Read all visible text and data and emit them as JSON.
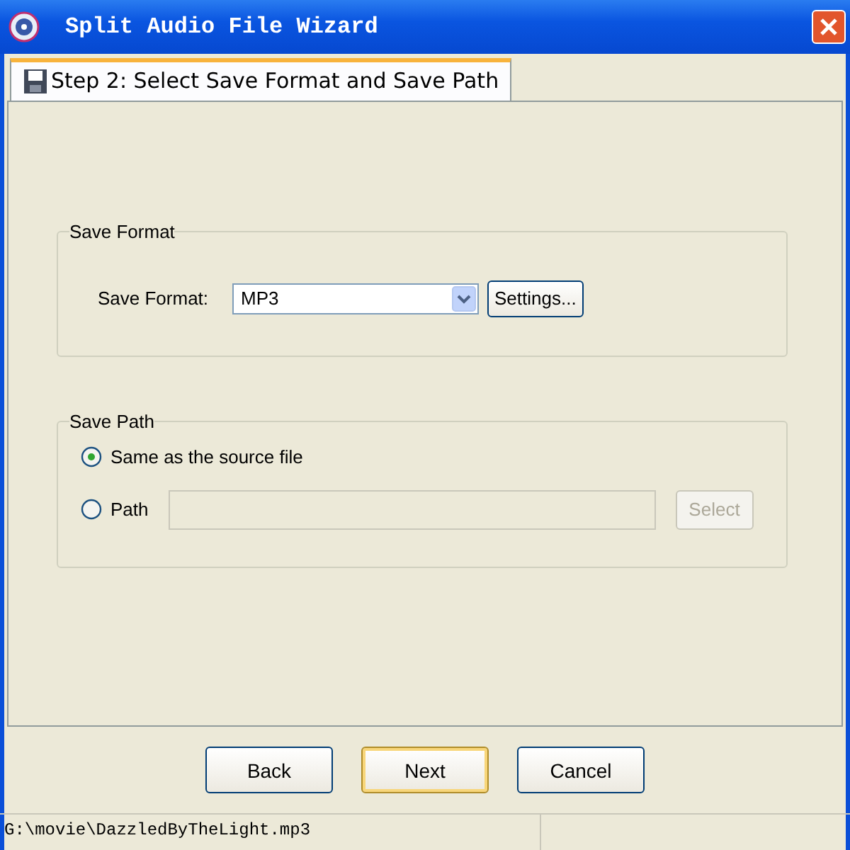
{
  "window": {
    "title": "Split Audio File Wizard"
  },
  "tabs": [
    {
      "label": "Step 2: Select Save Format and Save Path",
      "selected": true
    }
  ],
  "format_group": {
    "title": "Save Format",
    "label": "Save Format:",
    "value": "MP3",
    "settings_button": "Settings..."
  },
  "path_group": {
    "title": "Save Path",
    "options": [
      {
        "label": "Same as the source file",
        "selected": true
      },
      {
        "label": "Path",
        "selected": false
      }
    ],
    "path_field": {
      "disabled": true
    },
    "select_button": {
      "label": "Select",
      "disabled": true
    }
  },
  "buttons": [
    {
      "label": "Back",
      "default": false
    },
    {
      "label": "Next",
      "default": true
    },
    {
      "label": "Cancel",
      "default": false
    }
  ],
  "status_bar": {
    "text": "G:\\movie\\DazzledByTheLight.mp3"
  }
}
